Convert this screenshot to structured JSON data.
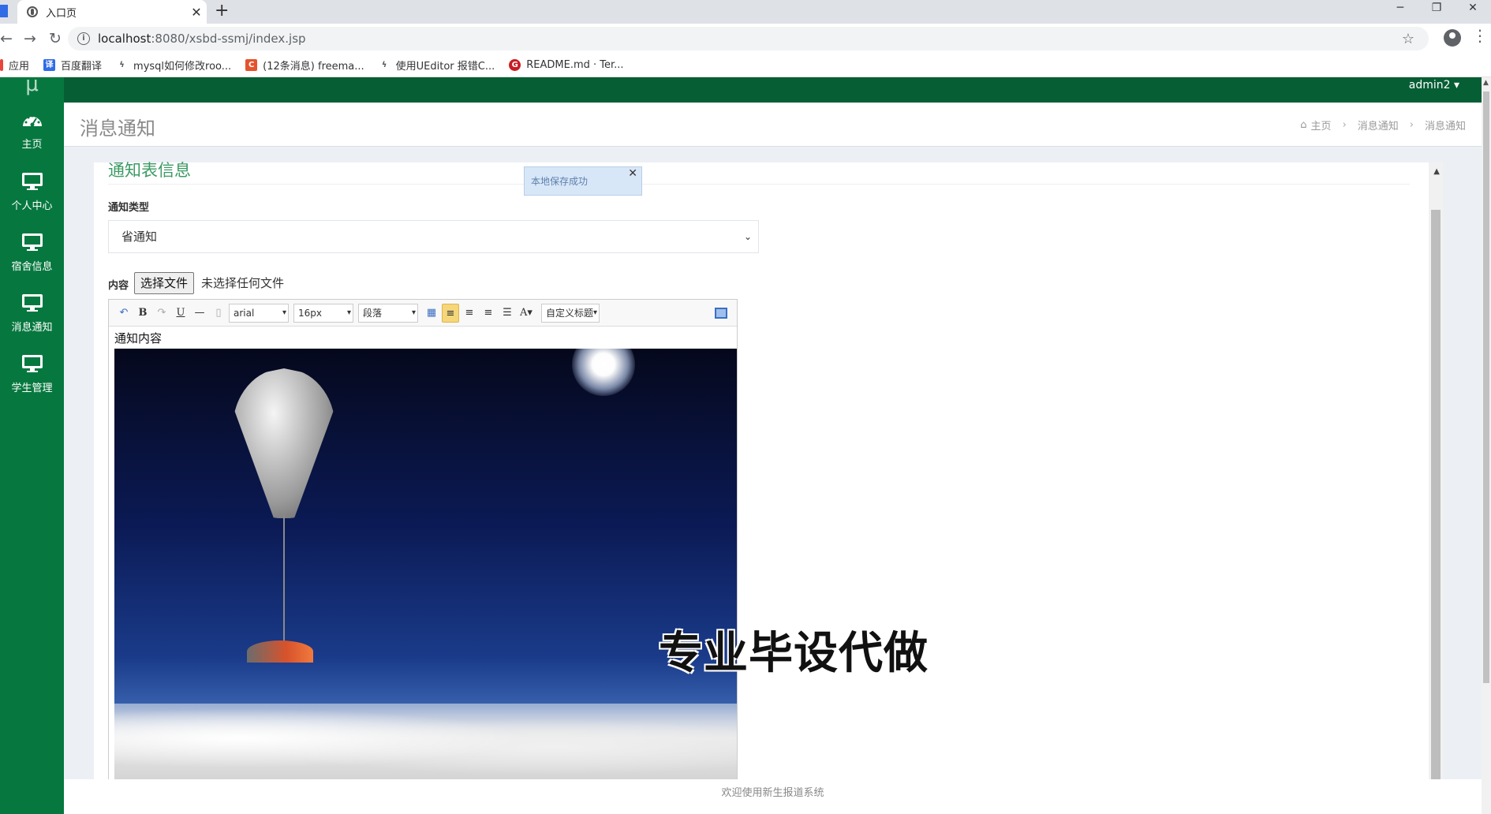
{
  "browser": {
    "tab_title": "入口页",
    "url_host": "localhost",
    "url_rest": ":8080/xsbd-ssmj/index.jsp",
    "bookmarks": [
      {
        "label": "应用",
        "color": "#e8453c"
      },
      {
        "label": "百度翻译",
        "color": "#2f6ce6"
      },
      {
        "label": "mysql如何修改roo...",
        "color": "#888888"
      },
      {
        "label": "(12条消息) freema...",
        "color": "#e5532d"
      },
      {
        "label": "使用UEditor 报错C...",
        "color": "#888888"
      },
      {
        "label": "README.md · Ter...",
        "color": "#c71d23"
      }
    ]
  },
  "sidebar": {
    "items": [
      {
        "label": "主页",
        "icon": "dashboard-icon"
      },
      {
        "label": "个人中心",
        "icon": "monitor-icon"
      },
      {
        "label": "宿舍信息",
        "icon": "monitor-icon"
      },
      {
        "label": "消息通知",
        "icon": "monitor-icon"
      },
      {
        "label": "学生管理",
        "icon": "monitor-icon"
      }
    ]
  },
  "topbar": {
    "user": "admin2 ▾"
  },
  "header": {
    "title": "消息通知",
    "breadcrumb": [
      "主页",
      "消息通知",
      "消息通知"
    ]
  },
  "form": {
    "section_title": "通知表信息",
    "type_label": "通知类型",
    "type_value": "省通知",
    "content_label": "内容",
    "file_button": "选择文件",
    "file_status": "未选择任何文件",
    "editor": {
      "font": "arial",
      "size": "16px",
      "paragraph": "段落",
      "custom_title": "自定义标题",
      "body_text": "通知内容"
    },
    "toast": "本地保存成功"
  },
  "watermark": "专业毕设代做",
  "footer": "欢迎使用新生报道系统",
  "colors": {
    "sidebar": "#06783f",
    "topbar": "#065e35",
    "accent": "#3c9a63"
  }
}
